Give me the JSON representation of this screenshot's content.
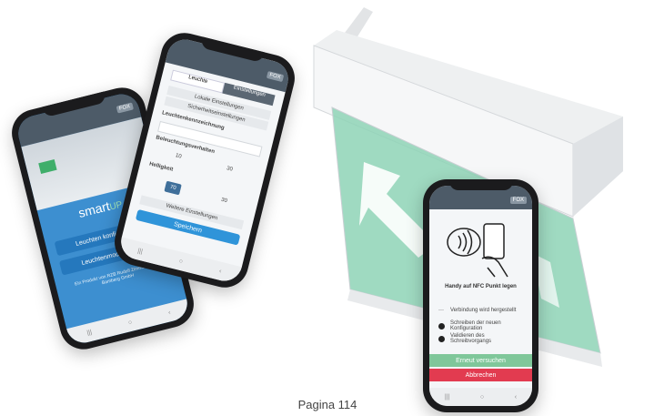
{
  "caption": "Pagina 114",
  "phone_left": {
    "tag": "FOX",
    "logo": "smart",
    "logo_accent": "UP",
    "button_1": "Leuchten konfigurieren",
    "button_2": "Leuchtenmodus laden",
    "footer": "Ein Produkt von RZB Rudolf Zimmermann, Bamberg GmbH"
  },
  "phone_middle": {
    "tag": "FOX",
    "tab_1": "Leuchte",
    "tab_2": "Einstellungen",
    "heading_1": "Lokale Einstellungen",
    "heading_2": "Sicherheitseinstellungen",
    "heading_3": "Leuchtenkennzeichnung",
    "heading_4": "Beleuchtungsverhalten",
    "val_1": "10",
    "val_2": "30",
    "heading_5": "Helligkeit",
    "val_3": "70",
    "val_4": "30",
    "heading_6": "Weitere Einstellungen",
    "button": "Speichern"
  },
  "phone_right": {
    "tag": "FOX",
    "caption": "Handy auf NFC Punkt legen",
    "step_1": "Verbindung wird hergestellt",
    "step_2": "Schreiben der neuen Konfiguration",
    "step_3": "Validieren des Schreibvorgangs",
    "button_green": "Erneut versuchen",
    "button_red": "Abbrechen"
  },
  "colors": {
    "accent_blue": "#2f94d9",
    "green": "#7fc79a",
    "red": "#e23b50",
    "exit_sign_green": "#8ed4b6"
  }
}
